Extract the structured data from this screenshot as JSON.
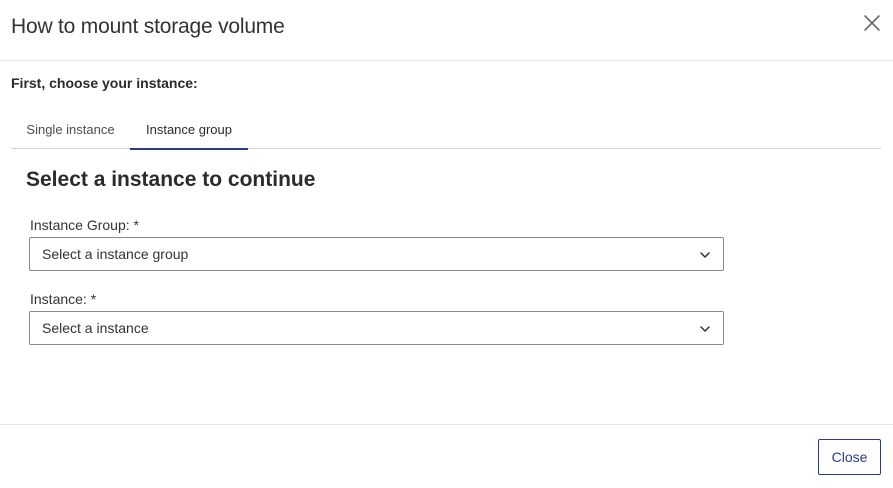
{
  "modal": {
    "title": "How to mount storage volume",
    "close_icon": "close-icon"
  },
  "intro": "First, choose your instance:",
  "tabs": [
    {
      "label": "Single instance",
      "active": false
    },
    {
      "label": "Instance group",
      "active": true
    }
  ],
  "section": {
    "title": "Select a instance to continue"
  },
  "fields": {
    "instance_group": {
      "label": "Instance Group: *",
      "selected": "Select a instance group",
      "icon": "chevron-down-icon"
    },
    "instance": {
      "label": "Instance: *",
      "selected": "Select a instance",
      "icon": "chevron-down-icon"
    }
  },
  "footer": {
    "close_label": "Close"
  },
  "colors": {
    "accent": "#2a3a8c",
    "border": "#8a8a8a",
    "divider": "#e4e4e4"
  }
}
